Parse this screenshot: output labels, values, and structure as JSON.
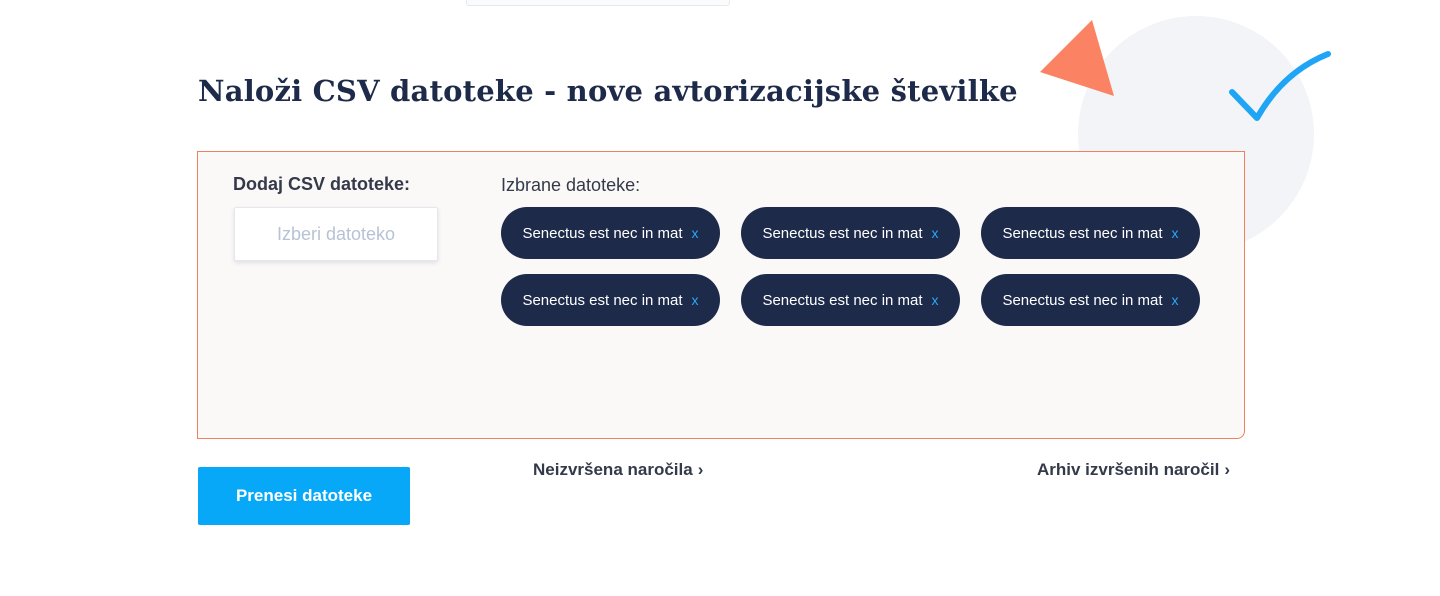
{
  "page": {
    "title": "Naloži CSV datoteke - nove avtorizacijske številke"
  },
  "upload": {
    "add_label": "Dodaj CSV datoteke:",
    "choose_file_label": "Izberi datoteko",
    "selected_label": "Izbrane datoteke:",
    "files": [
      {
        "name": "Senectus est nec in mat",
        "remove": "x"
      },
      {
        "name": "Senectus est nec in mat",
        "remove": "x"
      },
      {
        "name": "Senectus est nec in mat",
        "remove": "x"
      },
      {
        "name": "Senectus est nec in mat",
        "remove": "x"
      },
      {
        "name": "Senectus est nec in mat",
        "remove": "x"
      },
      {
        "name": "Senectus est nec in mat",
        "remove": "x"
      }
    ]
  },
  "actions": {
    "upload_button": "Prenesi datoteke",
    "pending_orders_link": "Neizvršena naročila",
    "archive_link": "Arhiv izvršenih naročil",
    "link_chevron": "›"
  },
  "colors": {
    "navy": "#1e2a4a",
    "accent_blue": "#08a8f8",
    "panel_border": "#f08062",
    "triangle": "#fb8263",
    "check": "#1ea5f5"
  },
  "icons": {
    "decor_triangle": "triangle-icon",
    "decor_check": "checkmark-icon",
    "remove": "close-icon"
  }
}
